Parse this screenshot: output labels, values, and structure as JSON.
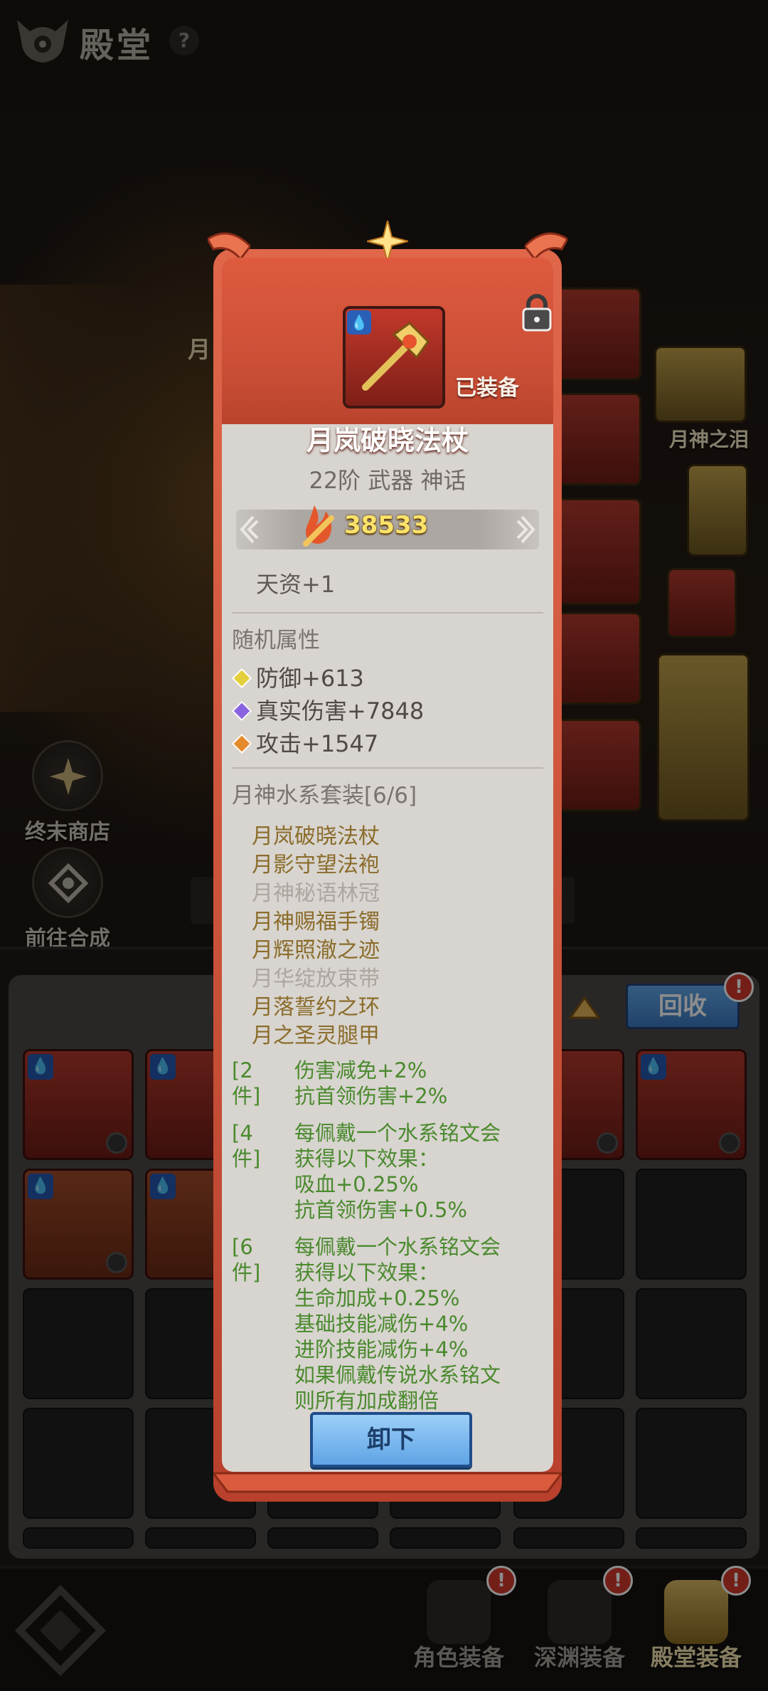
{
  "header": {
    "title": "殿堂",
    "help": "?"
  },
  "left_menu": {
    "shop_label": "终末商店",
    "craft_label": "前往合成",
    "partial_name": "月"
  },
  "right_panel": {
    "item_label": "月神之泪"
  },
  "bag": {
    "recycle_label": "回收",
    "badge": "!"
  },
  "item": {
    "name": "月岚破晓法杖",
    "equipped_label": "已装备",
    "grade": "22阶 武器 神话",
    "power": "38533",
    "talent": "天资+1",
    "random_title": "随机属性",
    "attributes": [
      {
        "text": "防御+613",
        "color": "#e3cf3a"
      },
      {
        "text": "真实伤害+7848",
        "color": "#8a63e0"
      },
      {
        "text": "攻击+1547",
        "color": "#e58a2a"
      }
    ],
    "set_title": "月神水系套装[6/6]",
    "set_items": [
      {
        "name": "月岚破晓法杖",
        "owned": true
      },
      {
        "name": "月影守望法袍",
        "owned": true
      },
      {
        "name": "月神秘语林冠",
        "owned": false
      },
      {
        "name": "月神赐福手镯",
        "owned": true
      },
      {
        "name": "月辉照澈之迹",
        "owned": true
      },
      {
        "name": "月华绽放束带",
        "owned": false
      },
      {
        "name": "月落誓约之环",
        "owned": true
      },
      {
        "name": "月之圣灵腿甲",
        "owned": true
      }
    ],
    "bonuses": [
      {
        "tag": "[2件]",
        "lines": [
          "伤害减免+2%",
          "抗首领伤害+2%"
        ]
      },
      {
        "tag": "[4件]",
        "lines": [
          "每佩戴一个水系铭文会",
          "获得以下效果：",
          "吸血+0.25%",
          "抗首领伤害+0.5%"
        ]
      },
      {
        "tag": "[6件]",
        "lines": [
          "每佩戴一个水系铭文会",
          "获得以下效果：",
          "生命加成+0.25%",
          "基础技能减伤+4%",
          "进阶技能减伤+4%",
          "如果佩戴传说水系铭文",
          "则所有加成翻倍"
        ]
      }
    ],
    "unequip_label": "卸下"
  },
  "nav": {
    "items": [
      {
        "label": "角色装备",
        "badge": "!"
      },
      {
        "label": "深渊装备",
        "badge": "!"
      },
      {
        "label": "殿堂装备",
        "badge": "!"
      }
    ]
  }
}
